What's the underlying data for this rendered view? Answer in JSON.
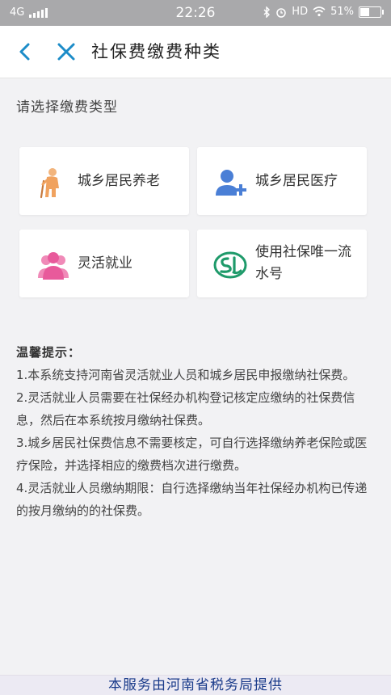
{
  "status_bar": {
    "network": "4G",
    "time": "22:26",
    "hd": "HD",
    "battery": "51%",
    "battery_level": 0.51
  },
  "nav": {
    "title": "社保费缴费种类",
    "back_icon": "chevron-left-icon",
    "close_icon": "close-icon",
    "accent_color": "#1c8cc8"
  },
  "section_label": "请选择缴费类型",
  "options": [
    {
      "label": "城乡居民养老",
      "icon": "elderly-person-icon",
      "color": "#f0a25f"
    },
    {
      "label": "城乡居民医疗",
      "icon": "user-add-icon",
      "color": "#4a7fd6"
    },
    {
      "label": "灵活就业",
      "icon": "people-group-icon",
      "color": "#e85a9b"
    },
    {
      "label": "使用社保唯一流水号",
      "icon": "social-security-logo-icon",
      "color": "#1e9a6a"
    }
  ],
  "tips": {
    "heading": "温馨提示：",
    "items": [
      "1.本系统支持河南省灵活就业人员和城乡居民申报缴纳社保费。",
      "2.灵活就业人员需要在社保经办机构登记核定应缴纳的社保费信息，然后在本系统按月缴纳社保费。",
      "3.城乡居民社保费信息不需要核定，可自行选择缴纳养老保险或医疗保险，并选择相应的缴费档次进行缴费。",
      "4.灵活就业人员缴纳期限：自行选择缴纳当年社保经办机构已传递的按月缴纳的的社保费。"
    ]
  },
  "footer": "本服务由河南省税务局提供"
}
